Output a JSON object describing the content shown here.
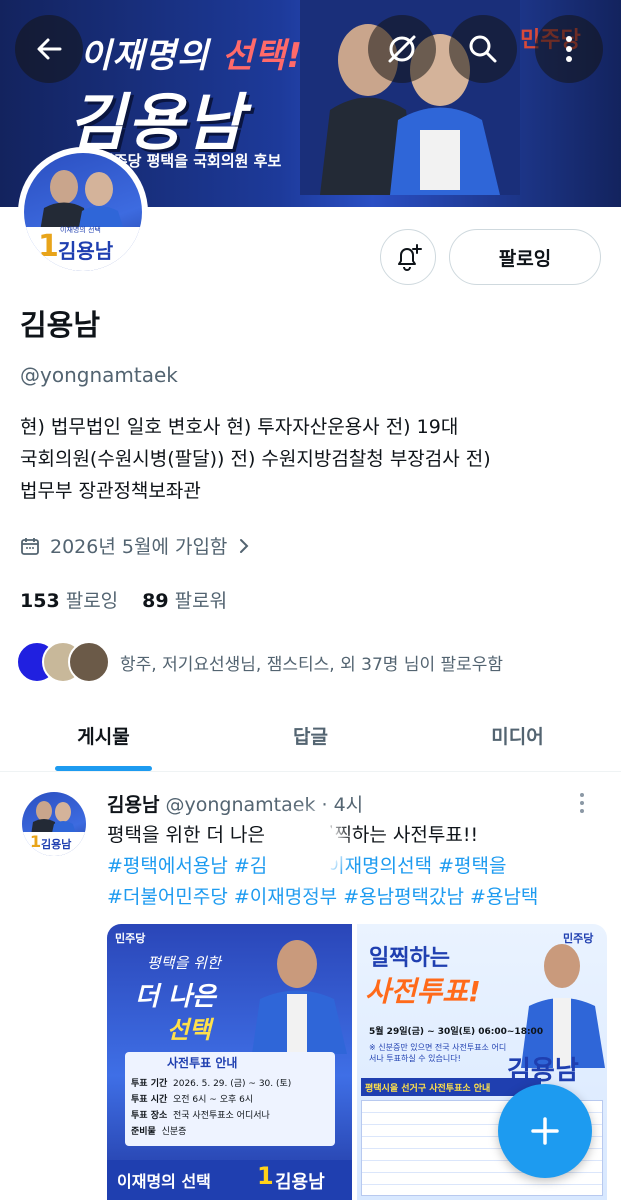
{
  "banner": {
    "title_prefix": "이재명의 ",
    "title_highlight": "선택!!",
    "name": "김용남",
    "subtitle": "민주당 평택을 국회의원 후보",
    "party_mark": "민주당"
  },
  "avatar": {
    "number": "1",
    "name": "김용남",
    "caption": "이재명의 선택"
  },
  "profile": {
    "follow_button": "팔로잉",
    "name": "김용남",
    "handle": "@yongnamtaek",
    "bio_lines": [
      "현) 법무법인 일호 변호사 현) 투자자산운용사 전) 19대",
      "국회의원(수원시병(팔달)) 전) 수원지방검찰청 부장검사 전)",
      "법무부 장관정책보좌관"
    ],
    "joined": "2026년 5월에 가입함",
    "following_count": "153",
    "following_label": "팔로잉",
    "followers_count": "89",
    "followers_label": "팔로워",
    "followed_by": "항주, 저기요선생님, 잼스티스, 외 37명 님이 팔로우함"
  },
  "tabs": [
    "게시물",
    "답글",
    "미디어"
  ],
  "post": {
    "author": "김용남",
    "handle": "@yongnamtaek",
    "time": "· 4시",
    "text_start": "평택을 위한 더 나은",
    "text_end": "일찍하는 사전투표!!",
    "hashtag_line1_a": "#평택에서용남 #김",
    "hashtag_line1_b": "#이재명의선택 #평택을",
    "hashtag_line2": "#더불어민주당 #이재명정부 #용남평택갔남 #용남택",
    "img1": {
      "party": "민주당",
      "line1": "평택을 위한",
      "line2": "더 나은",
      "line3": "선택",
      "panel_title": "사전투표 안내",
      "rows": [
        [
          "투표 기간",
          "2026. 5. 29. (금) ~ 30. (토)"
        ],
        [
          "투표 시간",
          "오전 6시 ~ 오후 6시"
        ],
        [
          "투표 장소",
          "전국 사전투표소 어디서나"
        ],
        [
          "준비물",
          "신분증"
        ]
      ],
      "footer": "이재명의 선택",
      "footer_num": "1",
      "footer_name": "김용남"
    },
    "img2": {
      "party": "민주당",
      "title1": "일찍하는",
      "title2": "사전투표!",
      "date": "5월 29일(금) ~ 30일(토) 06:00~18:00",
      "note": "※ 신분증만 있으면 전국 사전투표소 어디서나 투표하실 수 있습니다!",
      "name": "김용남",
      "table_title": "평택시을 선거구 사전투표소 안내"
    }
  },
  "colors": {
    "accent": "#1d9bf0",
    "party_blue": "#1f3fb0"
  }
}
